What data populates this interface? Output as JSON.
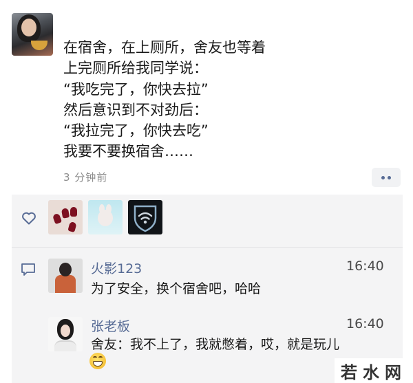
{
  "post": {
    "lines": [
      "在宿舍，在上厕所，舍友也等着",
      "上完厕所给我同学说：",
      "“我吃完了，你快去拉”",
      "然后意识到不对劲后：",
      "“我拉完了，你快去吃”",
      "我要不要换宿舍……"
    ],
    "time": "3 分钟前"
  },
  "likes": {
    "icon": "heart-outline-icon",
    "avatars": [
      "nails-avatar",
      "bunny-avatar",
      "wifi-shield-avatar"
    ]
  },
  "comments": [
    {
      "name": "火影123",
      "time": "16:40",
      "text": "为了安全，换个宿舍吧，哈哈"
    },
    {
      "name": "张老板",
      "time": "16:40",
      "text": "舍友：我不上了，我就憋着，哎，就是玩儿",
      "emoji": "grin-emoji"
    }
  ],
  "watermark": "若水网",
  "colors": {
    "name_link": "#576b95",
    "panel_bg": "#f4f4f5",
    "time_gray": "#8d8d8d"
  }
}
